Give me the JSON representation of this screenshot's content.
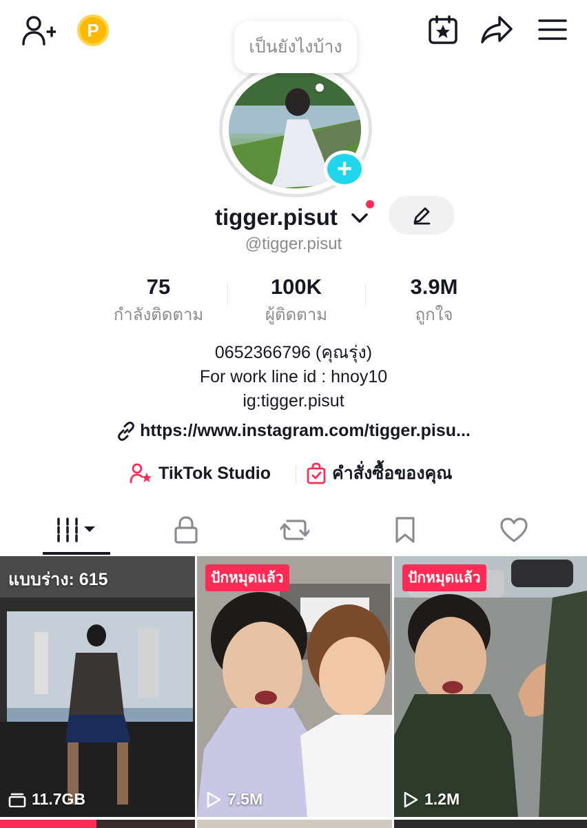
{
  "status_bubble": {
    "text": "เป็นยังไงบ้าง"
  },
  "profile": {
    "display_name": "tigger.pisut",
    "handle": "@tigger.pisut"
  },
  "stats": [
    {
      "value": "75",
      "label": "กำลังติดตาม"
    },
    {
      "value": "100K",
      "label": "ผู้ติดตาม"
    },
    {
      "value": "3.9M",
      "label": "ถูกใจ"
    }
  ],
  "bio": {
    "line1": "0652366796 (คุณรุ่ง)",
    "line2": "For work line id : hnoy10",
    "line3": "ig:tigger.pisut"
  },
  "link": {
    "text": "https://www.instagram.com/tigger.pisu..."
  },
  "tools": {
    "studio": "TikTok Studio",
    "orders": "คำสั่งซื้อของคุณ"
  },
  "videos": [
    {
      "draft_label": "แบบร่าง: 615",
      "meta": "11.7GB"
    },
    {
      "tag": "ปักหมุดแล้ว",
      "views": "7.5M"
    },
    {
      "tag": "ปักหมุดแล้ว",
      "views": "1.2M"
    }
  ],
  "colors": {
    "accent": "#fe2c55",
    "avatar_badge": "#20d5ec",
    "coin": "#ffb800",
    "secondary_text": "#8a8b91"
  },
  "icons": {
    "top_left": [
      "add-friend-icon",
      "coin-icon"
    ],
    "top_right": [
      "calendar-star-icon",
      "share-icon",
      "menu-icon"
    ],
    "tabs": [
      "grid-videos-icon",
      "lock-icon",
      "repost-icon",
      "bookmark-icon",
      "heart-icon"
    ]
  }
}
